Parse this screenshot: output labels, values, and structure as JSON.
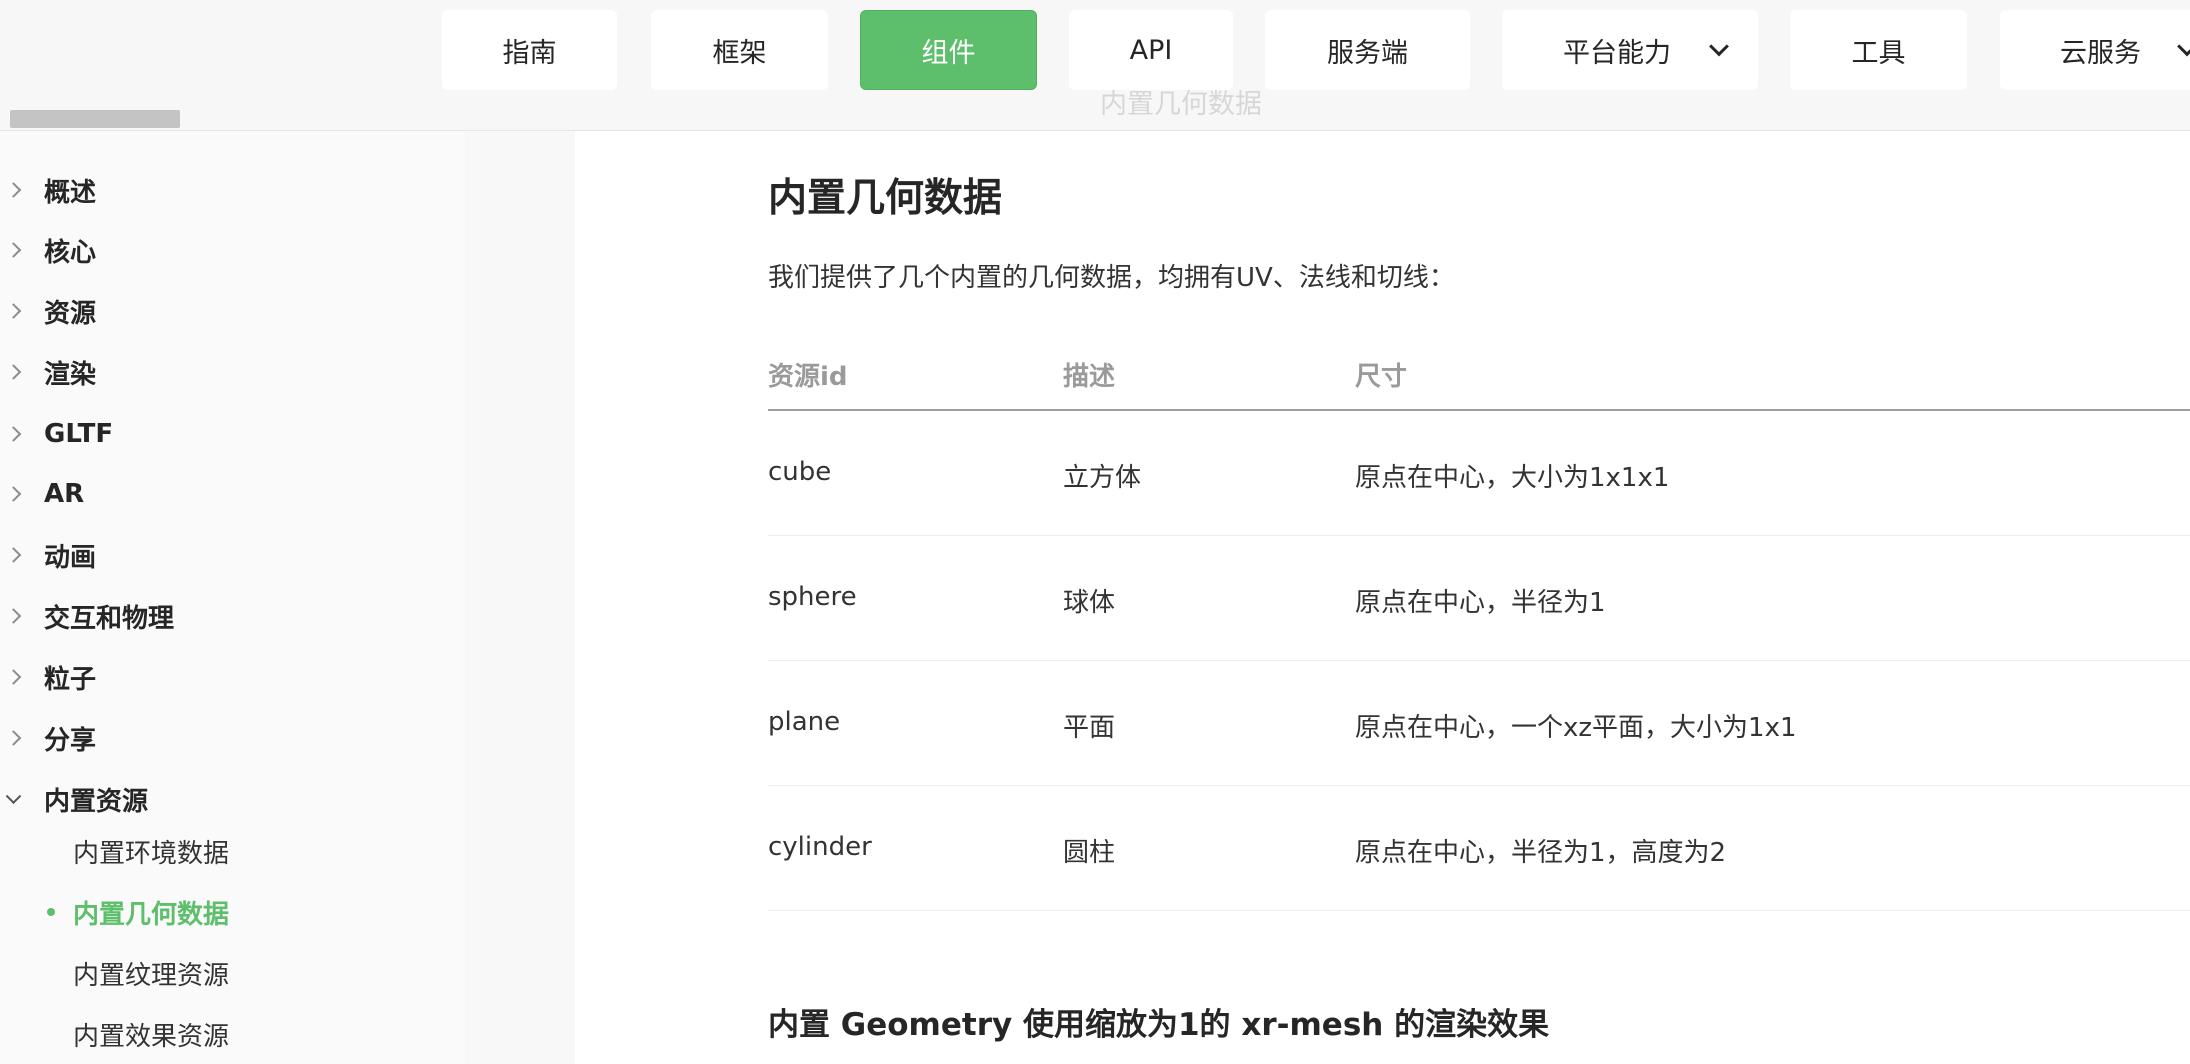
{
  "nav": {
    "items": [
      {
        "label": "指南"
      },
      {
        "label": "框架"
      },
      {
        "label": "组件"
      },
      {
        "label": "API"
      },
      {
        "label": "服务端"
      },
      {
        "label": "平台能力"
      },
      {
        "label": "工具"
      },
      {
        "label": "云服务"
      }
    ],
    "active_index": 2,
    "breadcrumb_ghost": "内置几何数据"
  },
  "sidebar": {
    "items": [
      {
        "label": "概述"
      },
      {
        "label": "核心"
      },
      {
        "label": "资源"
      },
      {
        "label": "渲染"
      },
      {
        "label": "GLTF"
      },
      {
        "label": "AR"
      },
      {
        "label": "动画"
      },
      {
        "label": "交互和物理"
      },
      {
        "label": "粒子"
      },
      {
        "label": "分享"
      },
      {
        "label": "内置资源"
      }
    ],
    "expanded_section": "内置资源",
    "subitems": [
      {
        "label": "内置环境数据"
      },
      {
        "label": "内置几何数据"
      },
      {
        "label": "内置纹理资源"
      },
      {
        "label": "内置效果资源"
      }
    ],
    "active_subitem": "内置几何数据"
  },
  "main": {
    "title": "内置几何数据",
    "intro": "我们提供了几个内置的几何数据，均拥有UV、法线和切线：",
    "table": {
      "headers": [
        "资源id",
        "描述",
        "尺寸"
      ],
      "rows": [
        [
          "cube",
          "立方体",
          "原点在中心，大小为1x1x1"
        ],
        [
          "sphere",
          "球体",
          "原点在中心，半径为1"
        ],
        [
          "plane",
          "平面",
          "原点在中心，一个xz平面，大小为1x1"
        ],
        [
          "cylinder",
          "圆柱",
          "原点在中心，半径为1，高度为2"
        ]
      ]
    },
    "section_title": "内置 Geometry 使用缩放为1的 xr-mesh 的渲染效果"
  },
  "colors": {
    "accent": "#5dbf6b",
    "text": "#262626",
    "muted": "#9a9a9a"
  }
}
